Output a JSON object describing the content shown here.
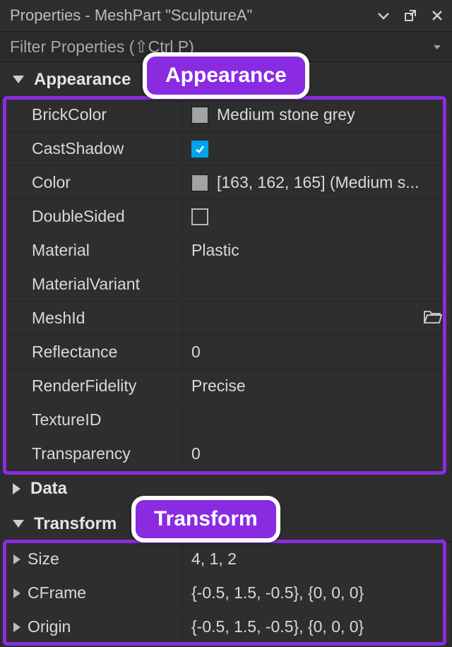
{
  "window": {
    "title": "Properties - MeshPart \"SculptureA\""
  },
  "filter": {
    "placeholder": "Filter Properties (⇧Ctrl P)"
  },
  "sections": {
    "appearance": {
      "label": "Appearance",
      "expanded": true
    },
    "data": {
      "label": "Data",
      "expanded": false
    },
    "transform": {
      "label": "Transform",
      "expanded": true
    }
  },
  "appearance": {
    "brickColor": {
      "label": "BrickColor",
      "value": "Medium stone grey",
      "swatch": "#a3a2a5"
    },
    "castShadow": {
      "label": "CastShadow",
      "checked": true
    },
    "color": {
      "label": "Color",
      "value": "[163, 162, 165] (Medium s...",
      "swatch": "#a3a2a5"
    },
    "doubleSided": {
      "label": "DoubleSided",
      "checked": false
    },
    "material": {
      "label": "Material",
      "value": "Plastic"
    },
    "materialVariant": {
      "label": "MaterialVariant",
      "value": ""
    },
    "meshId": {
      "label": "MeshId",
      "value": ""
    },
    "reflectance": {
      "label": "Reflectance",
      "value": "0"
    },
    "renderFidelity": {
      "label": "RenderFidelity",
      "value": "Precise"
    },
    "textureId": {
      "label": "TextureID",
      "value": ""
    },
    "transparency": {
      "label": "Transparency",
      "value": "0"
    }
  },
  "transform": {
    "size": {
      "label": "Size",
      "value": "4, 1, 2"
    },
    "cframe": {
      "label": "CFrame",
      "value": "{-0.5, 1.5, -0.5}, {0, 0, 0}"
    },
    "origin": {
      "label": "Origin",
      "value": "{-0.5, 1.5, -0.5}, {0, 0, 0}"
    }
  },
  "callouts": {
    "appearance": "Appearance",
    "transform": "Transform"
  }
}
